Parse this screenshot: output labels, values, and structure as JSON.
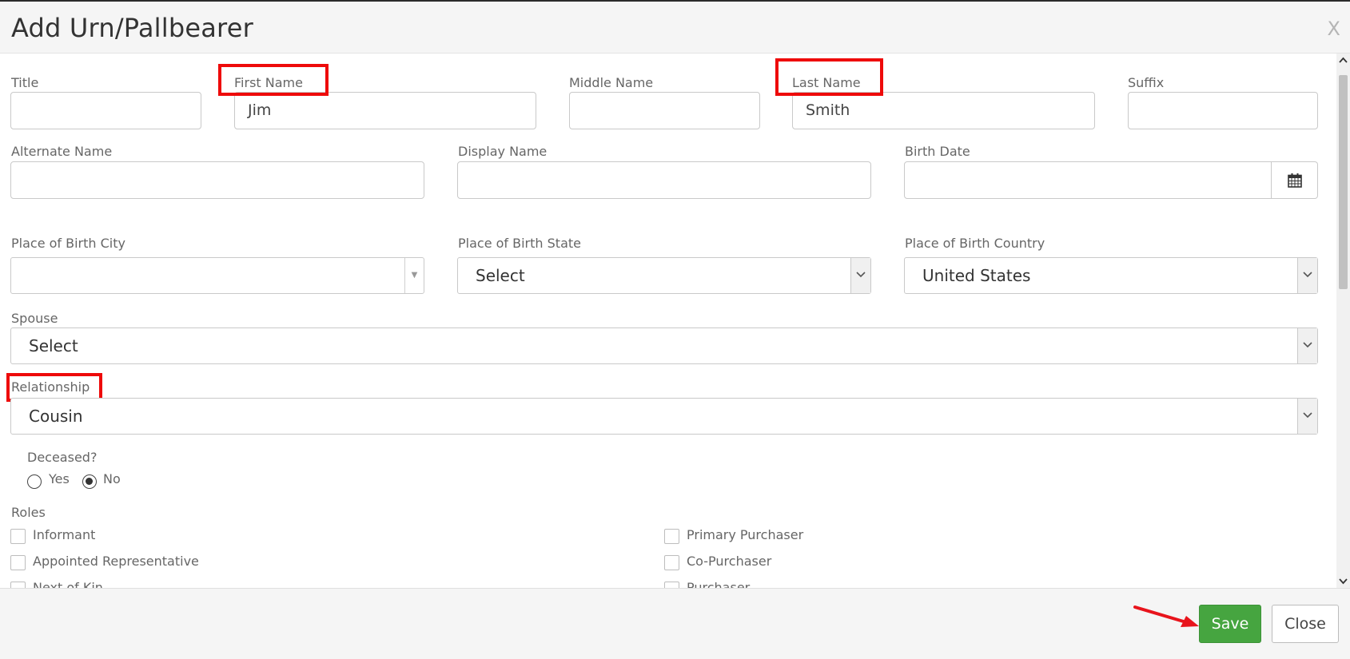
{
  "dialog": {
    "title": "Add Urn/Pallbearer",
    "close_glyph": "X"
  },
  "fields": {
    "title_label": "Title",
    "title_value": "",
    "first_name_label": "First Name",
    "first_name_value": "Jim",
    "middle_name_label": "Middle Name",
    "middle_name_value": "",
    "last_name_label": "Last Name",
    "last_name_value": "Smith",
    "suffix_label": "Suffix",
    "suffix_value": "",
    "alternate_name_label": "Alternate Name",
    "alternate_name_value": "",
    "display_name_label": "Display Name",
    "display_name_value": "",
    "birth_date_label": "Birth Date",
    "birth_date_value": "",
    "birth_city_label": "Place of Birth City",
    "birth_city_value": "",
    "birth_state_label": "Place of Birth State",
    "birth_state_value": "Select",
    "birth_country_label": "Place of Birth Country",
    "birth_country_value": "United States",
    "spouse_label": "Spouse",
    "spouse_value": "Select",
    "relationship_label": "Relationship",
    "relationship_value": "Cousin"
  },
  "deceased": {
    "label": "Deceased?",
    "yes": "Yes",
    "no": "No",
    "selected": "No"
  },
  "roles": {
    "label": "Roles",
    "left": [
      "Informant",
      "Appointed Representative",
      "Next of Kin"
    ],
    "right": [
      "Primary Purchaser",
      "Co-Purchaser",
      "Purchaser"
    ]
  },
  "footer": {
    "save_label": "Save",
    "close_label": "Close"
  },
  "colors": {
    "highlight": "#ee0a0a",
    "save_green": "#46a540"
  }
}
